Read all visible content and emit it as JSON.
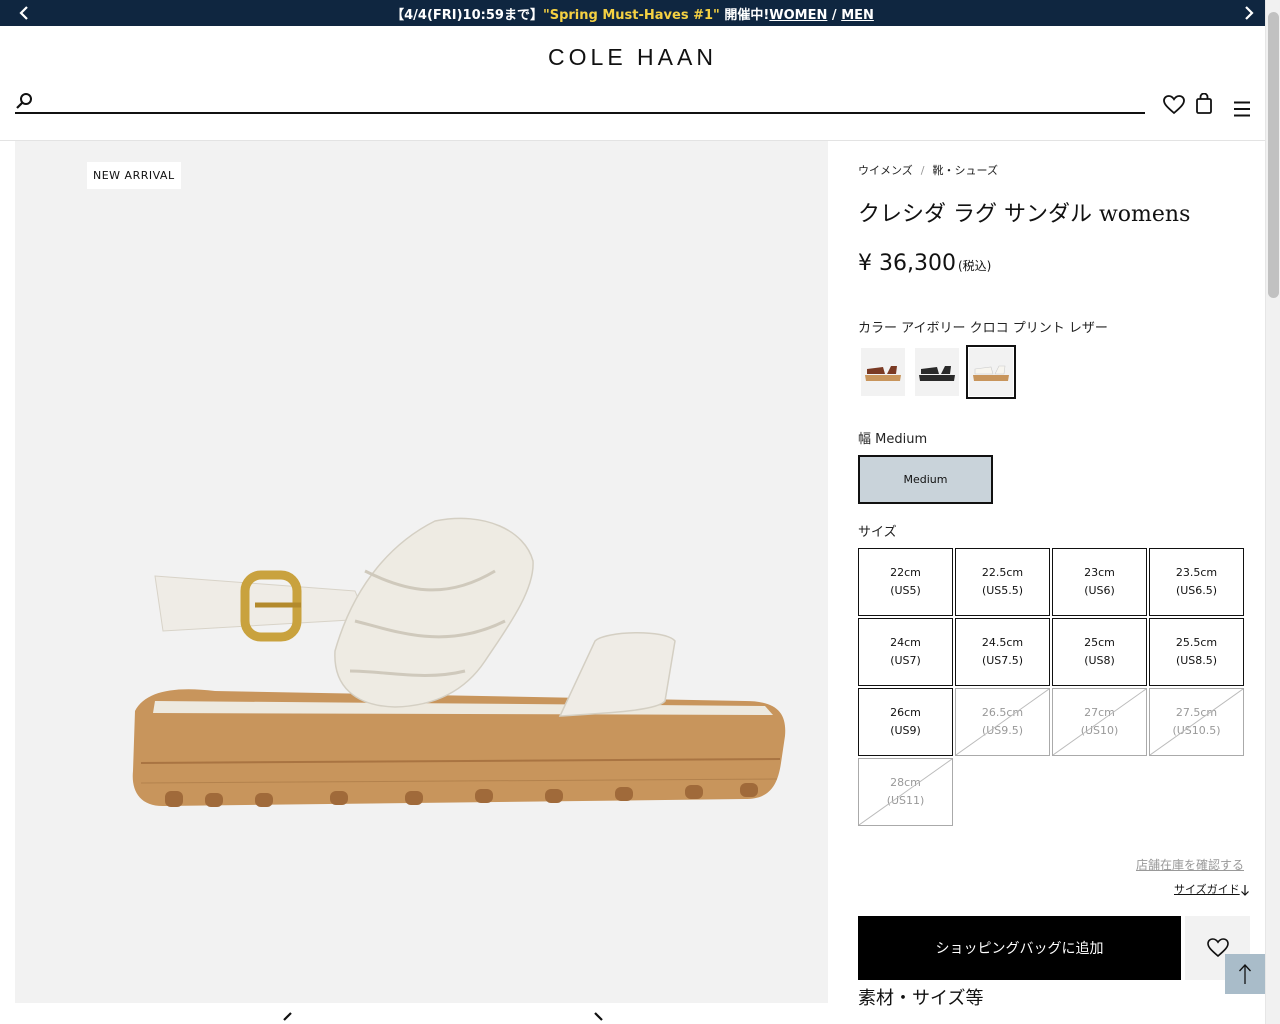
{
  "promo": {
    "prefix": "【4/4(FRI)10:59まで】",
    "highlight": "\"Spring Must-Haves #1\"",
    "suffix": " 開催中!",
    "women": "WOMEN",
    "divider": " / ",
    "men": "MEN"
  },
  "header": {
    "logo": "COLE HAAN",
    "search_placeholder": ""
  },
  "gallery": {
    "badge": "NEW ARRIVAL"
  },
  "breadcrumb": [
    "ウイメンズ",
    "/",
    "靴・シューズ"
  ],
  "product": {
    "title": "クレシダ ラグ サンダル womens",
    "price": "¥ 36,300",
    "tax_note": "(税込)",
    "color_label": "カラー アイボリー クロコ プリント レザー",
    "width_label": "幅 Medium",
    "width_option": "Medium",
    "size_label": "サイズ"
  },
  "swatch_colors": [
    "#7a3a24",
    "#2a2a2a",
    "#efece4"
  ],
  "sizes": [
    {
      "cm": "22cm",
      "us": "(US5)",
      "available": true
    },
    {
      "cm": "22.5cm",
      "us": "(US5.5)",
      "available": true
    },
    {
      "cm": "23cm",
      "us": "(US6)",
      "available": true
    },
    {
      "cm": "23.5cm",
      "us": "(US6.5)",
      "available": true
    },
    {
      "cm": "24cm",
      "us": "(US7)",
      "available": true
    },
    {
      "cm": "24.5cm",
      "us": "(US7.5)",
      "available": true
    },
    {
      "cm": "25cm",
      "us": "(US8)",
      "available": true
    },
    {
      "cm": "25.5cm",
      "us": "(US8.5)",
      "available": true
    },
    {
      "cm": "26cm",
      "us": "(US9)",
      "available": true
    },
    {
      "cm": "26.5cm",
      "us": "(US9.5)",
      "available": false
    },
    {
      "cm": "27cm",
      "us": "(US10)",
      "available": false
    },
    {
      "cm": "27.5cm",
      "us": "(US10.5)",
      "available": false
    },
    {
      "cm": "28cm",
      "us": "(US11)",
      "available": false
    }
  ],
  "actions": {
    "store_stock": "店舗在庫を確認する",
    "size_guide": "サイズガイド",
    "add_to_bag": "ショッピングバッグに追加"
  },
  "details_title": "素材・サイズ等",
  "colors": {
    "banner_bg": "#0f2640",
    "banner_highlight": "#f5d142",
    "width_selected_bg": "#c9d3da",
    "to_top_bg": "#a9bcc9"
  }
}
